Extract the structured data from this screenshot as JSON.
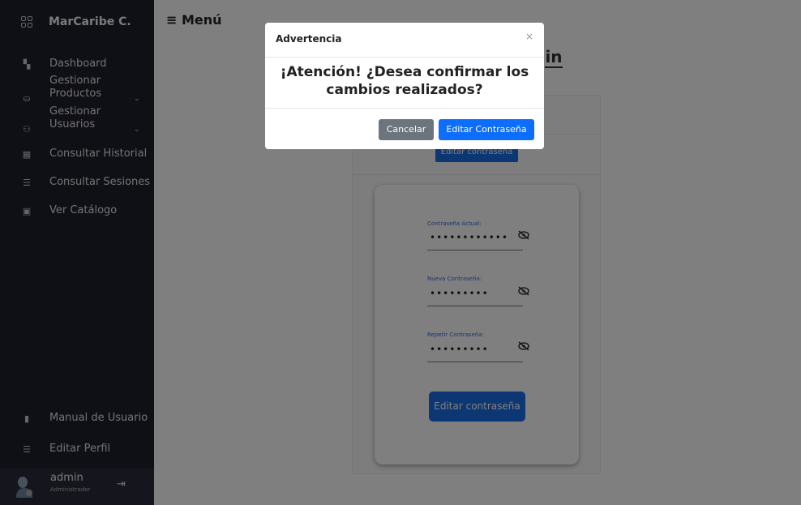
{
  "sidebar": {
    "brand": "MarCaribe C.",
    "items": [
      {
        "label": "Dashboard",
        "icon": "dashboard-icon"
      },
      {
        "label": "Gestionar Productos",
        "icon": "basket-icon"
      },
      {
        "label": "Gestionar Usuarios",
        "icon": "user-icon"
      },
      {
        "label": "Consultar Historial",
        "icon": "table-icon"
      },
      {
        "label": "Consultar Sesiones",
        "icon": "users-list-icon"
      },
      {
        "label": "Ver Catálogo",
        "icon": "store-icon"
      }
    ],
    "bottom_items": [
      {
        "label": "Manual de Usuario",
        "icon": "document-icon"
      },
      {
        "label": "Editar Perfil",
        "icon": "users-list-icon"
      }
    ],
    "user": {
      "name": "admin",
      "role": "Administrador"
    }
  },
  "header": {
    "menu_label": "Menú"
  },
  "page": {
    "title_visible": "in",
    "top_button": "Editar contraseña",
    "fields": [
      {
        "label": "Contraseña Actual:",
        "value": "••••••••••••"
      },
      {
        "label": "Nueva Contraseña:",
        "value": "•••••••••"
      },
      {
        "label": "Repetir Contraseña:",
        "value": "•••••••••"
      }
    ],
    "submit_button": "Editar contraseña"
  },
  "modal": {
    "title": "Advertencia",
    "close": "×",
    "body_line1": "¡Atención! ¿Desea confirmar los",
    "body_line2": "cambios realizados?",
    "cancel": "Cancelar",
    "confirm": "Editar Contraseña"
  },
  "colors": {
    "sidebar_bg": "#1e1e2d",
    "primary": "#0d6efd",
    "secondary": "#6c757d",
    "field_label": "#3766d8"
  }
}
